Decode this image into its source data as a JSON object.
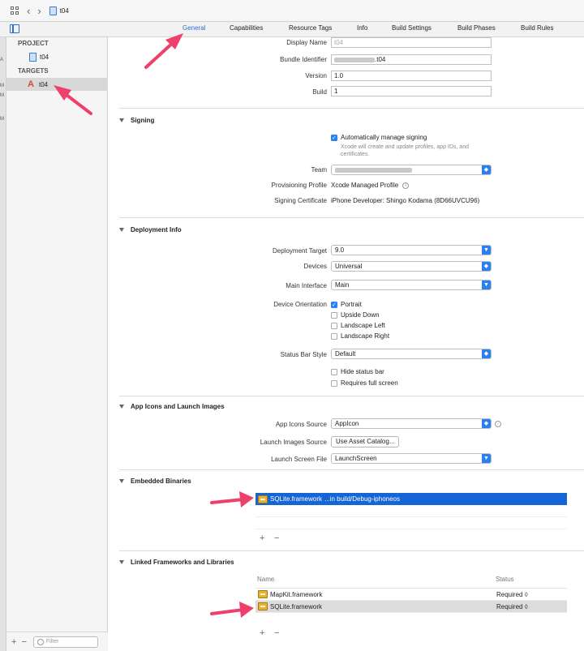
{
  "pathbar": {
    "project": "t04"
  },
  "tabs": [
    "General",
    "Capabilities",
    "Resource Tags",
    "Info",
    "Build Settings",
    "Build Phases",
    "Build Rules"
  ],
  "sidebar": {
    "project_header": "PROJECT",
    "project_item": "t04",
    "targets_header": "TARGETS",
    "target_item": "t04",
    "gutter_marks": [
      "A",
      "M",
      "M",
      "M"
    ],
    "add": "+",
    "remove": "−",
    "filter_placeholder": "Filter"
  },
  "identity": {
    "display_name_label": "Display Name",
    "display_name_placeholder": "t04",
    "bundle_id_label": "Bundle Identifier",
    "bundle_id_suffix": ".t04",
    "version_label": "Version",
    "version_value": "1.0",
    "build_label": "Build",
    "build_value": "1"
  },
  "signing": {
    "title": "Signing",
    "auto_label": "Automatically manage signing",
    "auto_hint": "Xcode will create and update profiles, app IDs, and certificates.",
    "team_label": "Team",
    "profile_label": "Provisioning Profile",
    "profile_value": "Xcode Managed Profile",
    "cert_label": "Signing Certificate",
    "cert_value": "iPhone Developer: Shingo Kodama (8D66UVCU96)"
  },
  "deployment": {
    "title": "Deployment Info",
    "target_label": "Deployment Target",
    "target_value": "9.0",
    "devices_label": "Devices",
    "devices_value": "Universal",
    "main_interface_label": "Main Interface",
    "main_interface_value": "Main",
    "orientation_label": "Device Orientation",
    "orientations": [
      {
        "label": "Portrait",
        "checked": true
      },
      {
        "label": "Upside Down",
        "checked": false
      },
      {
        "label": "Landscape Left",
        "checked": false
      },
      {
        "label": "Landscape Right",
        "checked": false
      }
    ],
    "status_bar_label": "Status Bar Style",
    "status_bar_value": "Default",
    "hide_status_bar": "Hide status bar",
    "requires_full_screen": "Requires full screen"
  },
  "app_icons": {
    "title": "App Icons and Launch Images",
    "icons_source_label": "App Icons Source",
    "icons_source_value": "AppIcon",
    "launch_images_label": "Launch Images Source",
    "launch_images_button": "Use Asset Catalog...",
    "launch_screen_label": "Launch Screen File",
    "launch_screen_value": "LaunchScreen"
  },
  "embedded": {
    "title": "Embedded Binaries",
    "item_name": "SQLite.framework",
    "item_path": "...in build/Debug-iphoneos",
    "add": "+",
    "remove": "−"
  },
  "linked": {
    "title": "Linked Frameworks and Libraries",
    "col_name": "Name",
    "col_status": "Status",
    "rows": [
      {
        "name": "MapKit.framework",
        "status": "Required ◊"
      },
      {
        "name": "SQLite.framework",
        "status": "Required ◊"
      }
    ],
    "add": "+",
    "remove": "−"
  },
  "colors": {
    "accent": "#2b6fd6",
    "selection": "#1565d6",
    "annotation_arrow": "#ef3f6b"
  }
}
